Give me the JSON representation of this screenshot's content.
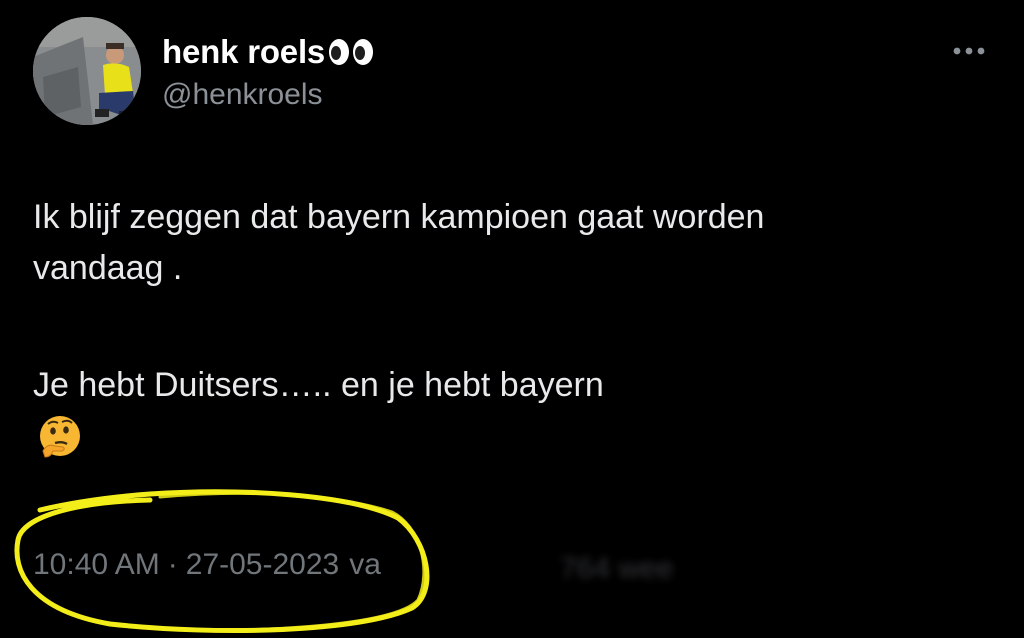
{
  "tweet": {
    "author": {
      "display_name": "henk roels",
      "name_emoji_icon": "eyes-emoji-icon",
      "handle": "@henkroels",
      "avatar_icon": "profile-photo"
    },
    "more_icon": "ellipsis-icon",
    "text_lines": [
      "Ik blijf zeggen dat bayern kampioen gaat worden",
      "vandaag ."
    ],
    "text_second_paragraph": "Je hebt Duitsers….. en je hebt bayern",
    "trailing_emoji_icon": "thinking-face-emoji-icon",
    "meta": {
      "time": "10:40 AM",
      "separator": "·",
      "date": "27-05-2023",
      "partial_via": "va",
      "partial_views": "764 wee"
    }
  },
  "colors": {
    "background": "#000000",
    "name_text": "#ffffff",
    "body_text": "#e7e9ea",
    "secondary_text": "#71767b",
    "highlight_marker": "#f3ee19"
  }
}
